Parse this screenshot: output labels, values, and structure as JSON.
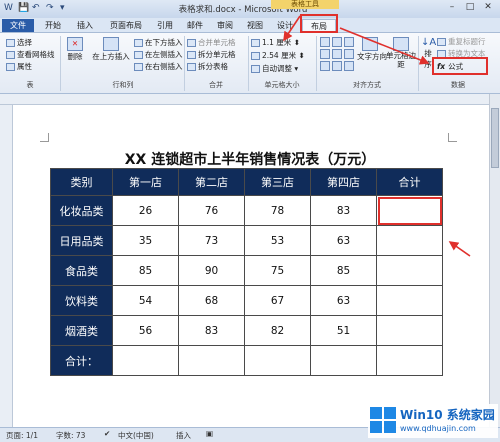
{
  "window": {
    "title": "表格求和.docx - Microsoft Word",
    "context_tab_group": "表格工具",
    "controls": [
      "–",
      "□",
      "✕"
    ]
  },
  "tabs": [
    "文件",
    "开始",
    "插入",
    "页面布局",
    "引用",
    "邮件",
    "审阅",
    "视图",
    "设计",
    "布局"
  ],
  "ribbon": {
    "table_group": {
      "items": [
        "选择",
        "查看网格线",
        "属性"
      ],
      "label": "表"
    },
    "delete_label": "删除",
    "insert_above_label": "在上方插入",
    "rows_cols": {
      "items": [
        "在下方插入",
        "在左侧插入",
        "在右侧插入"
      ],
      "label": "行和列"
    },
    "merge": {
      "items": [
        "合并单元格",
        "拆分单元格",
        "拆分表格"
      ],
      "label": "合并"
    },
    "cell_size": {
      "height": "1.1 厘米",
      "width": "2.54 厘米",
      "autofit": "自动调整",
      "label": "单元格大小"
    },
    "align": {
      "direction": "文字方向",
      "margins": "单元格边距",
      "label": "对齐方式"
    },
    "sort_label": "排序",
    "data": {
      "items": [
        "重复标题行",
        "转换为文本",
        "公式"
      ],
      "label": "数据"
    }
  },
  "document": {
    "title": "XX 连锁超市上半年销售情况表（万元）",
    "header": [
      "类别",
      "第一店",
      "第二店",
      "第三店",
      "第四店",
      "合计"
    ],
    "rows": [
      {
        "label": "化妆品类",
        "values": [
          "26",
          "76",
          "78",
          "83",
          ""
        ]
      },
      {
        "label": "日用品类",
        "values": [
          "35",
          "73",
          "53",
          "63",
          ""
        ]
      },
      {
        "label": "食品类",
        "values": [
          "85",
          "90",
          "75",
          "85",
          ""
        ]
      },
      {
        "label": "饮料类",
        "values": [
          "54",
          "68",
          "67",
          "63",
          ""
        ]
      },
      {
        "label": "烟酒类",
        "values": [
          "56",
          "83",
          "82",
          "51",
          ""
        ]
      },
      {
        "label": "合计：",
        "values": [
          "",
          "",
          "",
          "",
          ""
        ]
      }
    ]
  },
  "status": {
    "page": "页面: 1/1",
    "words": "字数: 73",
    "language": "中文(中国)",
    "mode": "插入"
  },
  "watermark": {
    "brand": "Win10 系统家园",
    "url": "www.qdhuajin.com"
  },
  "colors": {
    "header_bg": "#102c5a",
    "annotation_red": "#e0302c",
    "file_tab": "#2a5ca8"
  }
}
